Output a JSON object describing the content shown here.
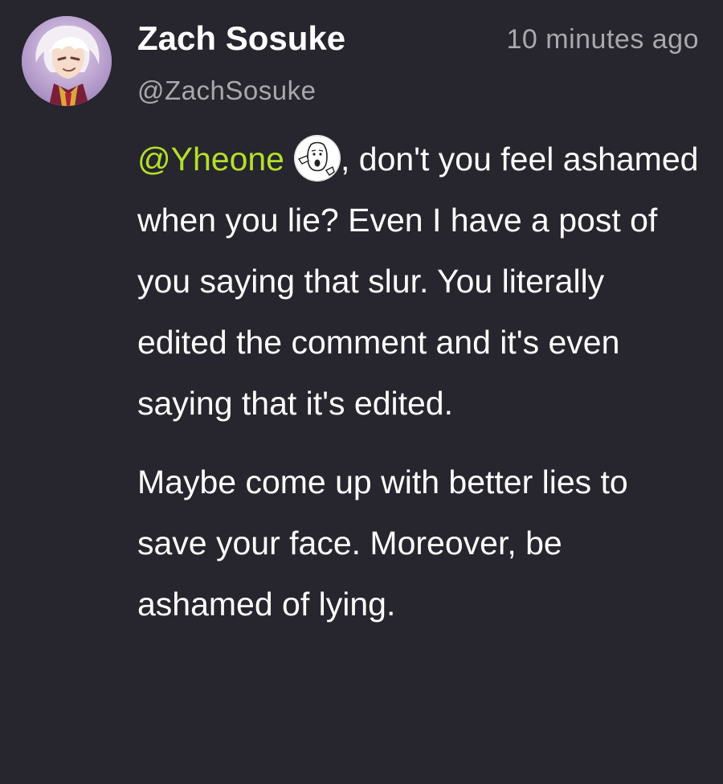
{
  "comment": {
    "author": {
      "name": "Zach Sosuke",
      "handle": "@ZachSosuke",
      "avatar_icon": "anime-avatar-icon"
    },
    "timestamp": "10 minutes ago",
    "mention": {
      "text": "@Yheone",
      "avatar_icon": "wojak-avatar-icon",
      "color": "#b4e02a"
    },
    "first_paragraph_rest": ", don't you feel ashamed when you lie? Even I have a post of you saying that slur. You literally edited the comment and it's even saying that it's edited.",
    "second_paragraph": "Maybe come up with better lies to save your face. Moreover, be ashamed of lying."
  },
  "colors": {
    "background": "#27252d",
    "text": "#ffffff",
    "secondary_text": "#a9a8ad",
    "mention": "#b4e02a"
  }
}
